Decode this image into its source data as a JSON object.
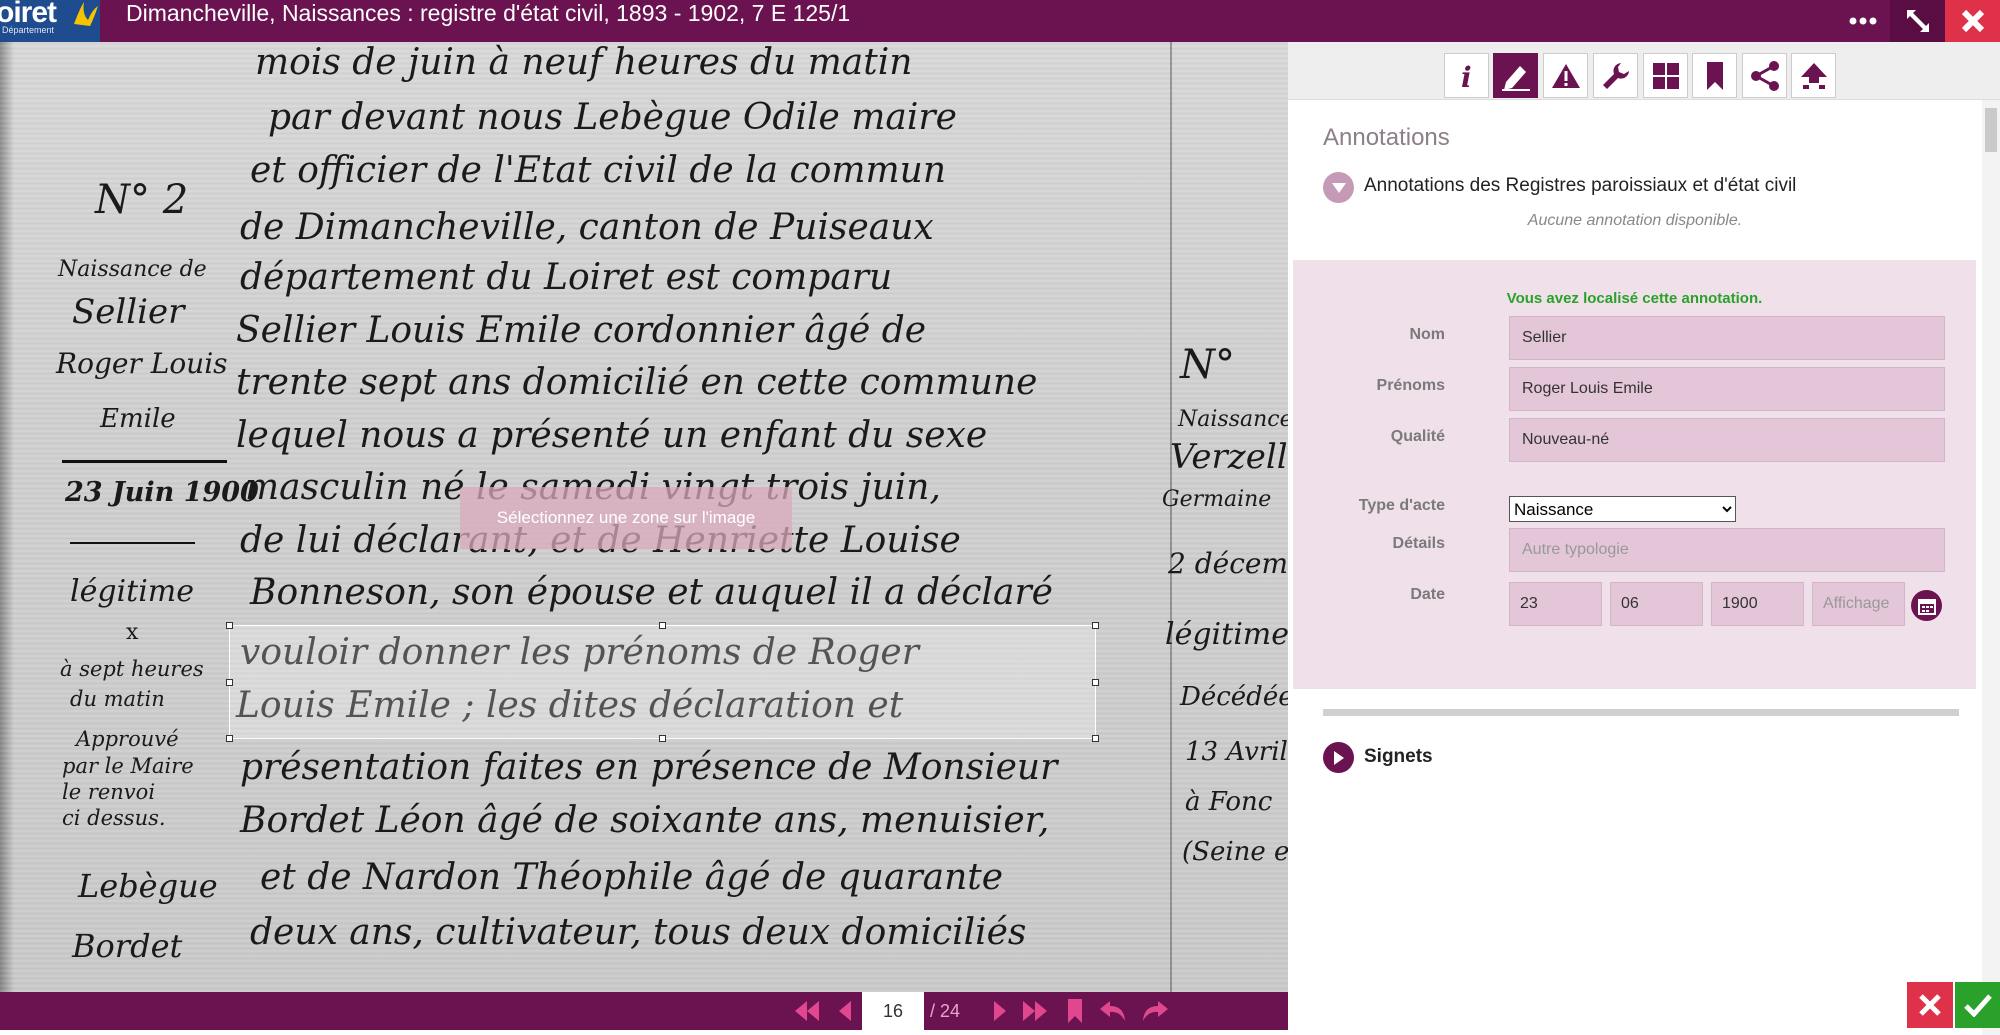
{
  "header": {
    "logo_text": "oiret",
    "logo_sub": "Département",
    "title": "Dimancheville, Naissances : registre d'état civil, 1893 - 1902, 7 E 125/1",
    "more_icon": "more-dots-icon",
    "expand_icon": "expand-icon",
    "close_icon": "close-icon"
  },
  "viewer": {
    "selection_hint": "Sélectionnez une zone sur l'image",
    "main_lines": [
      "mois de juin à neuf heures du matin",
      "par devant nous Lebègue Odile maire",
      "et officier de l'Etat civil de la commun",
      "de Dimancheville, canton de Puiseaux",
      "département du Loiret est comparu",
      "Sellier Louis Emile cordonnier âgé de",
      "trente sept ans domicilié en cette commune",
      "lequel nous a présenté un enfant du sexe",
      "masculin né le samedi vingt trois juin,",
      "de lui déclarant, et de Henriette Louise",
      "Bonneson, son épouse et auquel il a déclaré",
      "vouloir donner les prénoms de Roger",
      "Louis Emile ; les dites déclaration et",
      "présentation faites en présence de Monsieur",
      "Bordet Léon âgé de soixante ans, menuisier,",
      "et de Nardon Théophile âgé de quarante",
      "deux ans, cultivateur, tous deux domiciliés"
    ],
    "margin_lines": [
      "N° 2",
      "Naissance de",
      "Sellier",
      "Roger Louis",
      "Emile",
      "23 Juin 1900",
      "légitime",
      "x",
      "à sept heures",
      "du matin",
      "Approuvé",
      "par le Maire",
      "le renvoi",
      "ci dessus.",
      "Lebègue",
      "Bordet"
    ],
    "right_margin_lines": [
      "N°",
      "Naissance",
      "Verzell",
      "Germaine",
      "2 décemb",
      "légitime",
      "Décédée",
      "13 Avril",
      "à Fonc",
      "(Seine et"
    ]
  },
  "navigation": {
    "current_page": "16",
    "total_pages": "/ 24",
    "icons": [
      "first-page-icon",
      "previous-page-icon",
      "next-page-icon",
      "last-page-icon",
      "bookmark-icon",
      "undo-icon",
      "redo-icon"
    ]
  },
  "panel": {
    "toolbar_icons": [
      "info-icon",
      "annotate-pen-icon",
      "warning-icon",
      "wrench-icon",
      "grid-icon",
      "bookmark-icon",
      "share-icon",
      "tree-icon"
    ],
    "active_tool": "annotate-pen-icon",
    "heading": "Annotations",
    "section_title": "Annotations des Registres paroissiaux et d'état civil",
    "no_annotation": "Aucune annotation disponible.",
    "form": {
      "success_message": "Vous avez localisé cette annotation.",
      "nom_label": "Nom",
      "nom_value": "Sellier",
      "prenoms_label": "Prénoms",
      "prenoms_value": "Roger Louis Emile",
      "qualite_label": "Qualité",
      "qualite_value": "Nouveau-né",
      "type_label": "Type d'acte",
      "type_value": "Naissance",
      "details_label": "Détails",
      "details_placeholder": "Autre typologie",
      "date_label": "Date",
      "date_day": "23",
      "date_month": "06",
      "date_year": "1900",
      "date_display_placeholder": "Affichage"
    },
    "signets_label": "Signets"
  },
  "actions": {
    "cancel_icon": "close-icon",
    "confirm_icon": "check-icon"
  },
  "colors": {
    "brand_purple": "#6a1350",
    "form_background": "#efe0ea",
    "input_background": "#e3c6d8",
    "success_green": "#2aa12a",
    "danger_red": "#e0314a"
  }
}
